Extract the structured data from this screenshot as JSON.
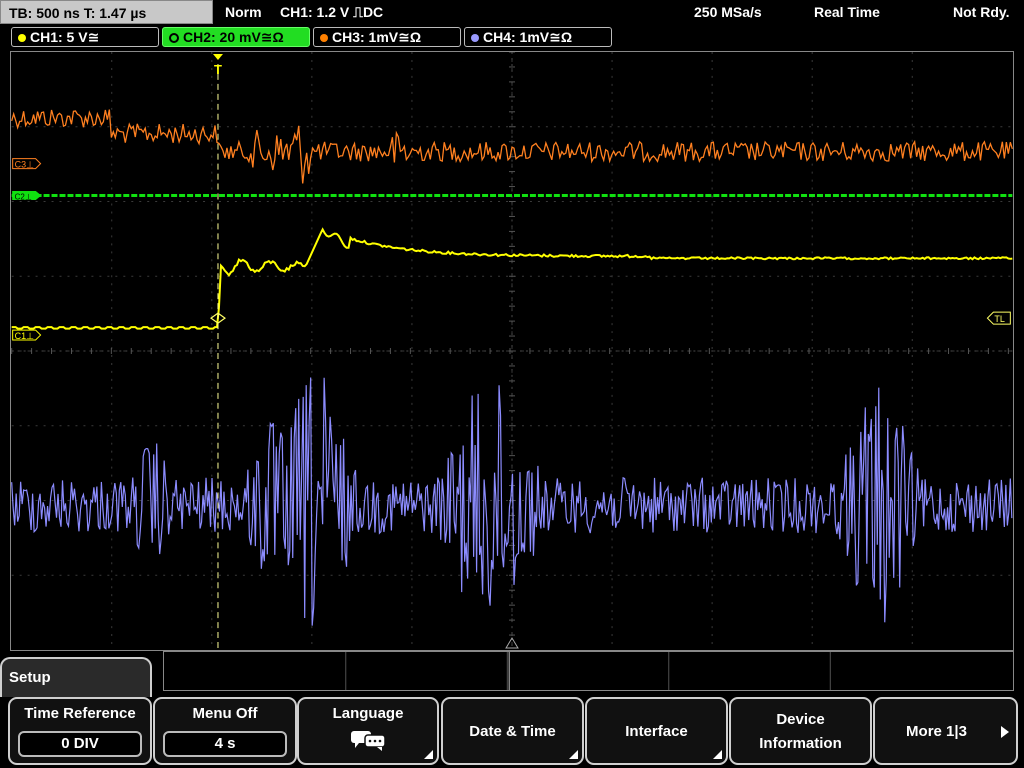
{
  "status": {
    "timebase": "TB: 500 ns  T: 1.47 µs",
    "mode": "Norm",
    "trigger": "CH1: 1.2 V ⎍DC",
    "sample_rate": "250 MSa/s",
    "acq_mode": "Real Time",
    "ready_state": "Not Rdy."
  },
  "channels": [
    {
      "label": "CH1: 5 V≅",
      "color": "#ffff00"
    },
    {
      "label": "CH2: 20 mV≅Ω",
      "color": "#00ff00"
    },
    {
      "label": "CH3: 1mV≅Ω",
      "color": "#ff8000"
    },
    {
      "label": "CH4: 1mV≅Ω",
      "color": "#9a9aff"
    }
  ],
  "markers": {
    "c3": "C3⊥",
    "c2": "C2⊥",
    "c1": "C1⊥",
    "tl": "TL",
    "trigger": "T"
  },
  "menu": {
    "title": "Setup",
    "time_reference": {
      "label": "Time Reference",
      "value": "0 DIV"
    },
    "menu_off": {
      "label": "Menu Off",
      "value": "4 s"
    },
    "language": {
      "label": "Language"
    },
    "date_time": {
      "label": "Date & Time"
    },
    "interface": {
      "label": "Interface"
    },
    "device_info": {
      "line1": "Device",
      "line2": "Information"
    },
    "more": {
      "label": "More 1|3"
    }
  }
}
